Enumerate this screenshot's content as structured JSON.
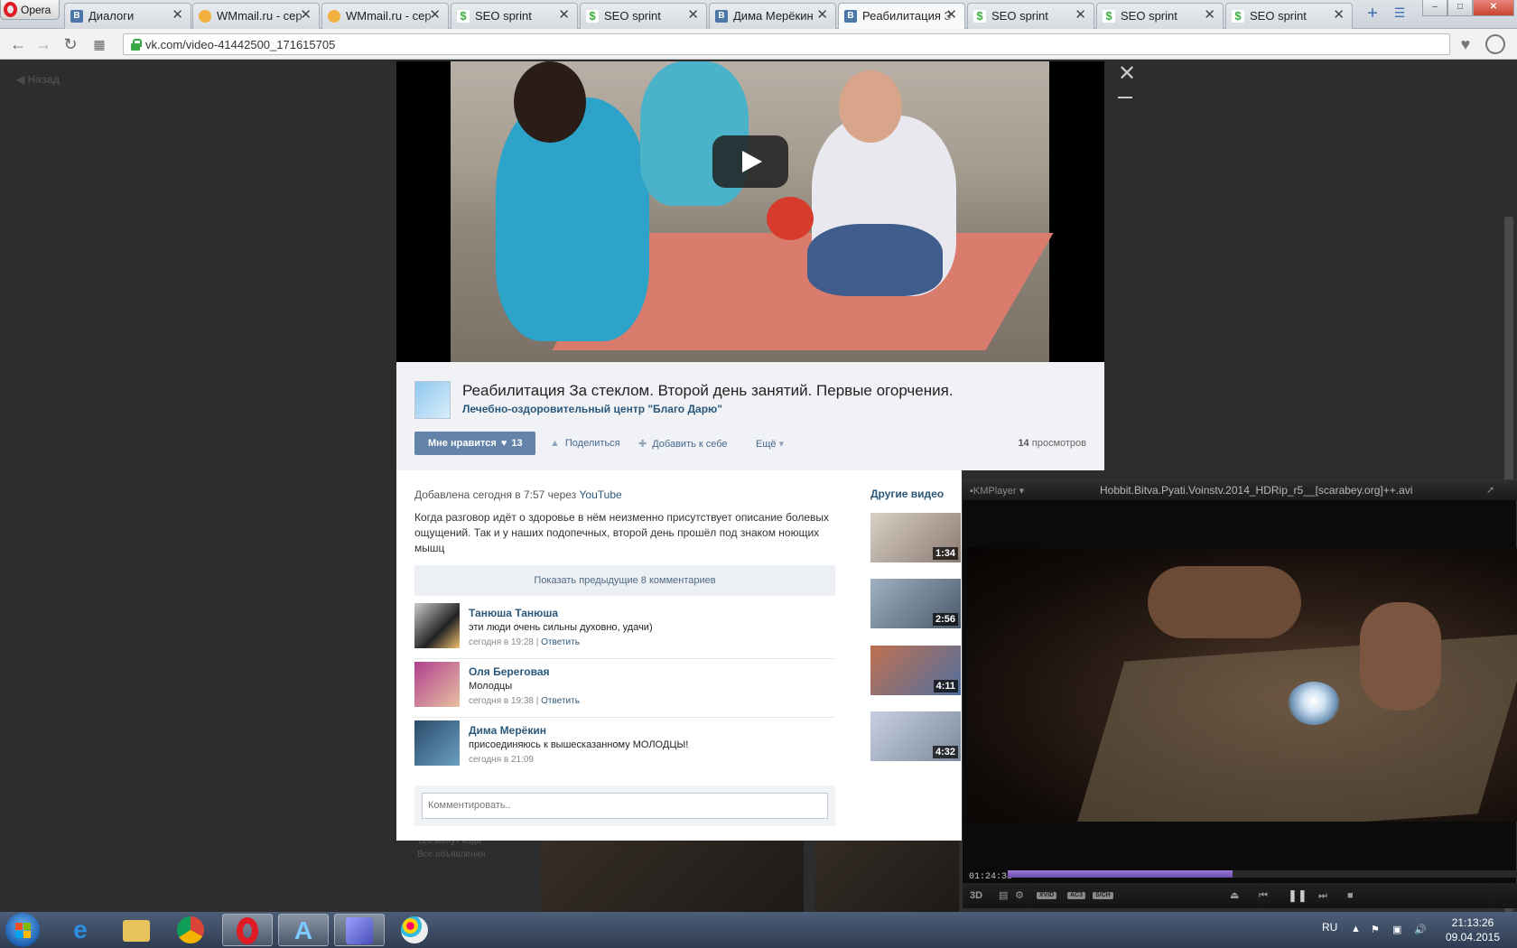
{
  "browser": {
    "menu_label": "Opera",
    "tabs": [
      {
        "title": "Диалоги",
        "favicon": "vk-icon",
        "active": false
      },
      {
        "title": "WMmail.ru - сер",
        "favicon": "wmmail-icon",
        "active": false
      },
      {
        "title": "WMmail.ru - сер",
        "favicon": "wmmail-icon",
        "active": false
      },
      {
        "title": "SEO sprint",
        "favicon": "seosprint-icon",
        "active": false
      },
      {
        "title": "SEO sprint",
        "favicon": "seosprint-icon",
        "active": false
      },
      {
        "title": "Дима Мерёкин",
        "favicon": "vk-icon",
        "active": false
      },
      {
        "title": "Реабилитация З",
        "favicon": "vk-icon",
        "active": true
      },
      {
        "title": "SEO sprint",
        "favicon": "seosprint-icon",
        "active": false
      },
      {
        "title": "SEO sprint",
        "favicon": "seosprint-icon",
        "active": false
      },
      {
        "title": "SEO sprint",
        "favicon": "seosprint-icon",
        "active": false
      }
    ],
    "tab_close": "✕",
    "new_tab": "+",
    "url": "vk.com/video-41442500_171615705"
  },
  "page": {
    "back_label": "Назад",
    "bg_ad_lines": [
      "120 минут кода",
      "Все объявления"
    ]
  },
  "video": {
    "title": "Реабилитация За стеклом. Второй день занятий. Первые огорчения.",
    "channel": "Лечебно-оздоровительный центр \"Благо Дарю\"",
    "like_label": "Мне нравится",
    "like_count": "13",
    "share_label": "Поделиться",
    "add_label": "Добавить к себе",
    "more_label": "Ещё",
    "views_count": "14",
    "views_label": "просмотров",
    "added_text": "Добавлена сегодня в 7:57 через",
    "added_source": "YouTube",
    "description": "Когда разговор идёт о здоровье в нём неизменно присутствует описание болевых ощущений. Так и у наших подопечных, второй день прошёл под знаком ноющих мышц",
    "show_prev_comments": "Показать предыдущие 8 комментариев",
    "comment_placeholder": "Комментировать..",
    "comments": [
      {
        "author": "Танюша Танюша",
        "text": "эти люди очень сильны духовно, удачи)",
        "date": "сегодня в 19:28",
        "reply": "Ответить"
      },
      {
        "author": "Оля Береговая",
        "text": "Молодцы",
        "date": "сегодня в 19:38",
        "reply": "Ответить"
      },
      {
        "author": "Дима Мерёкин",
        "text": "присоединяюсь к вышесказанному МОЛОДЦЫ!",
        "date": "сегодня в 21:09",
        "reply": ""
      }
    ],
    "other_title": "Другие видео",
    "other_videos": [
      {
        "duration": "1:34"
      },
      {
        "duration": "2:56"
      },
      {
        "duration": "4:11"
      },
      {
        "duration": "4:32"
      }
    ]
  },
  "kmplayer": {
    "brand": "KMPlayer",
    "filename": "Hobbit.Bitva.Pyati.Voinstv.2014_HDRip_r5__[scarabey.org]++.avi",
    "time": "01:24:38",
    "progress": 0.44,
    "badges": [
      "XVID",
      "AC3",
      "S/CH"
    ],
    "label_3d": "3D"
  },
  "taskbar": {
    "lang": "RU",
    "time": "21:13:26",
    "date": "09.04.2015"
  },
  "colors": {
    "vk_blue": "#6383a8",
    "vk_link": "#2b587a",
    "kmp_progress": "#7c5cc4",
    "opera_red": "#e01b24"
  }
}
